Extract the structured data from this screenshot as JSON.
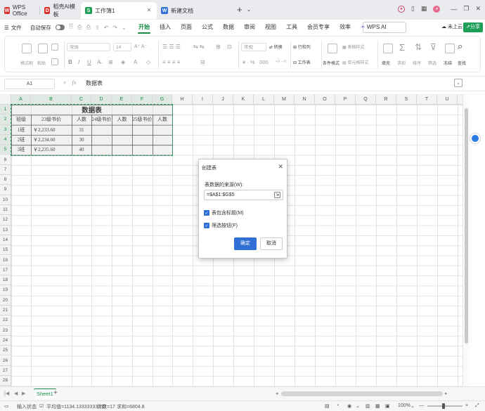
{
  "tabs": [
    {
      "label": "WPS Office",
      "icon": "wps-logo-icon",
      "color": "#d9302c"
    },
    {
      "label": "稻壳AI模板",
      "icon": "docer-icon",
      "color": "#d9302c"
    },
    {
      "label": "工作簿1",
      "icon": "spreadsheet-icon",
      "color": "#1e9e57",
      "active": true
    },
    {
      "label": "新建文档",
      "icon": "document-icon",
      "color": "#2f6fd6"
    }
  ],
  "menubar": {
    "file_label": "文件",
    "autosave_label": "自动保存",
    "items": [
      "开始",
      "插入",
      "页面",
      "公式",
      "数据",
      "审阅",
      "视图",
      "工具",
      "会员专享",
      "效率",
      "WPS AI"
    ],
    "active_index": 0,
    "cloud_label": "未上云",
    "share_label": "分享"
  },
  "ribbon": {
    "format_painter": "格式刷",
    "paste": "粘贴",
    "font_name": "宋体",
    "font_size": "14",
    "number_format": "常规",
    "convert": "转换",
    "rows_cols": "行和列",
    "worksheet": "工作表",
    "cond_format": "条件格式",
    "table_style": "表格样式",
    "cell_style": "单元格样式",
    "fill": "填充",
    "sum": "求和",
    "sort": "排序",
    "filter": "筛选",
    "freeze": "冻结",
    "find": "查找"
  },
  "formula_bar": {
    "cell_ref": "A1",
    "content": "数据表"
  },
  "grid": {
    "columns": [
      "A",
      "B",
      "C",
      "D",
      "E",
      "F",
      "G",
      "H",
      "I",
      "J",
      "K",
      "L",
      "M",
      "N",
      "O",
      "P",
      "Q",
      "R",
      "S",
      "T",
      "U",
      "V"
    ],
    "row_count": 29,
    "title": "数据表",
    "headers": [
      "班级",
      "23级书价",
      "人数",
      "24级书价",
      "人数",
      "25级书价",
      "人数"
    ],
    "rows": [
      [
        "1班",
        "￥2,233.60",
        "31",
        "",
        "",
        "",
        ""
      ],
      [
        "2班",
        "￥2,234.60",
        "30",
        "",
        "",
        "",
        ""
      ],
      [
        "3班",
        "￥2,235.60",
        "40",
        "",
        "",
        "",
        ""
      ]
    ]
  },
  "sheets": {
    "tabs": [
      "Sheet1"
    ]
  },
  "statusbar": {
    "input_state": "输入状态",
    "average": "平均值=1134.13333333333",
    "count": "计数=17",
    "sum": "求和=6804.8",
    "zoom": "100%"
  },
  "dialog": {
    "title": "创建表",
    "source_label": "表数据的来源(W):",
    "source_value": "=$A$1:$G$5",
    "has_headers_label": "表包含标题(M)",
    "has_headers_checked": true,
    "filter_button_label": "筛选按钮(F)",
    "filter_button_checked": true,
    "ok_label": "确定",
    "cancel_label": "取消"
  },
  "colors": {
    "accent_green": "#1e9e57",
    "primary_blue": "#2f6fd6"
  }
}
